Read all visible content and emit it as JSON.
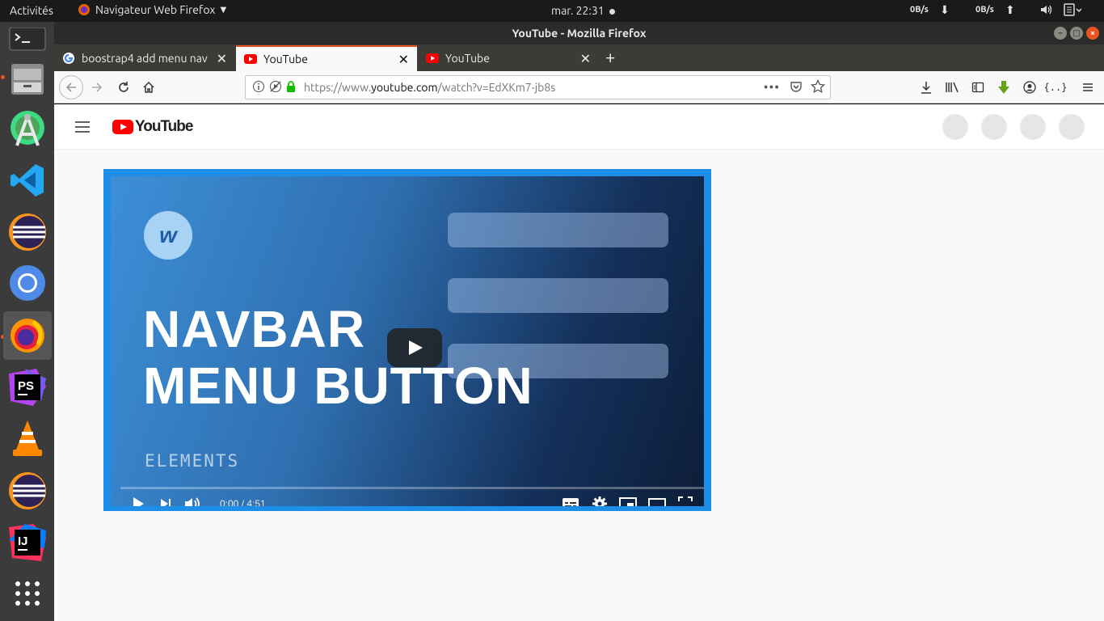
{
  "topbar": {
    "activities": "Activités",
    "app_menu": "Navigateur Web Firefox",
    "clock": "mar. 22:31",
    "net_down": "0B/s",
    "net_up": "0B/s"
  },
  "dock": {
    "items": [
      {
        "name": "terminal"
      },
      {
        "name": "files"
      },
      {
        "name": "android-studio"
      },
      {
        "name": "vscode"
      },
      {
        "name": "eclipse"
      },
      {
        "name": "chromium"
      },
      {
        "name": "firefox"
      },
      {
        "name": "phpstorm",
        "label": "PS"
      },
      {
        "name": "vlc"
      },
      {
        "name": "eclipse-2"
      },
      {
        "name": "intellij",
        "label": "IJ"
      },
      {
        "name": "show-applications"
      }
    ]
  },
  "window": {
    "title": "YouTube - Mozilla Firefox"
  },
  "tabs": [
    {
      "title": "boostrap4 add menu nav",
      "favicon": "google"
    },
    {
      "title": "YouTube",
      "favicon": "youtube",
      "selected": true
    },
    {
      "title": "YouTube",
      "favicon": "youtube"
    }
  ],
  "url": {
    "prefix": "https://www.",
    "domain": "youtube.com",
    "path": "/watch?v=EdXKm7-jb8s"
  },
  "youtube": {
    "logo_text": "YouTube"
  },
  "video": {
    "thumb_title_line1": "NAVBAR",
    "thumb_title_line2": "MENU BUTTON",
    "thumb_brand": "ELEMENTS",
    "thumb_logo": "w",
    "time": "0:00 / 4:51",
    "progress": 0
  }
}
